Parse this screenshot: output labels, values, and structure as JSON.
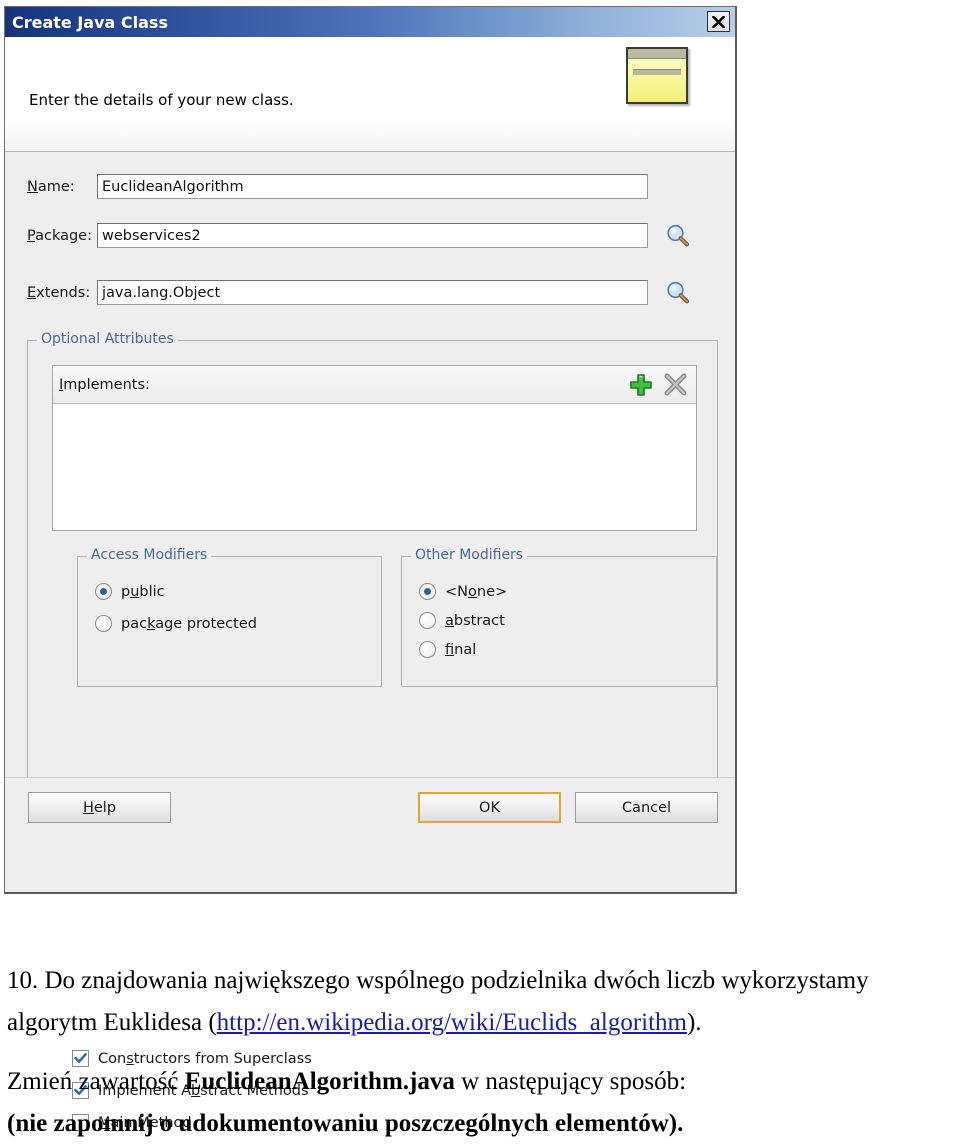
{
  "dialog": {
    "title": "Create Java Class",
    "close_label": "×",
    "header_text": "Enter the details of your new class.",
    "fields": [
      {
        "label_pre": "",
        "label_mn": "N",
        "label_post": "ame:",
        "value": "EuclideanAlgorithm",
        "has_browse": false
      },
      {
        "label_pre": "",
        "label_mn": "P",
        "label_post": "ackage:",
        "value": "webservices2",
        "has_browse": true
      },
      {
        "label_pre": "",
        "label_mn": "E",
        "label_post": "xtends:",
        "value": "java.lang.Object",
        "has_browse": true
      }
    ],
    "optional_attributes": {
      "legend": "Optional Attributes",
      "implements": {
        "label_mn": "I",
        "label_post": "mplements:",
        "items": [],
        "add_icon": "plus-icon",
        "remove_icon": "remove-x-icon"
      },
      "access_modifiers": {
        "legend": "Access Modifiers",
        "options": [
          {
            "pre": "p",
            "mn": "u",
            "post": "blic",
            "selected": true
          },
          {
            "pre": "pac",
            "mn": "k",
            "post": "age protected",
            "selected": false
          }
        ]
      },
      "other_modifiers": {
        "legend": "Other Modifiers",
        "options": [
          {
            "pre": "<N",
            "mn": "o",
            "post": "ne>",
            "selected": true
          },
          {
            "pre": "",
            "mn": "a",
            "post": "bstract",
            "selected": false
          },
          {
            "pre": "",
            "mn": "f",
            "post": "inal",
            "selected": false
          }
        ]
      },
      "checkboxes": [
        {
          "pre": "Con",
          "mn": "s",
          "post": "tructors from Superclass",
          "checked": true
        },
        {
          "pre": "Implement A",
          "mn": "b",
          "post": "stract Methods",
          "checked": true
        },
        {
          "pre": "",
          "mn": "M",
          "post": "ain Method",
          "checked": false
        }
      ]
    },
    "buttons": {
      "help": {
        "pre": "",
        "mn": "H",
        "post": "elp"
      },
      "ok": "OK",
      "cancel": "Cancel"
    },
    "accent_focus_color": "#e8a33d",
    "titlebar_color": "#16337c"
  },
  "caption": {
    "para1_line1": "10. Do znajdowania największego wspólnego podzielnika dwóch liczb wykorzystamy",
    "para1_line2_pre": "algorytm Euklidesa (",
    "para1_link": "http://en.wikipedia.org/wiki/Euclids_algorithm",
    "para1_line2_post": ").",
    "para2_line1_pre": "Zmień zawartość ",
    "para2_line1_bold": "EuclideanAlgorithm.java",
    "para2_line1_post": " w następujący sposób:",
    "para2_line2": "(nie zapomnij o udokumentowaniu poszczególnych elementów)."
  }
}
